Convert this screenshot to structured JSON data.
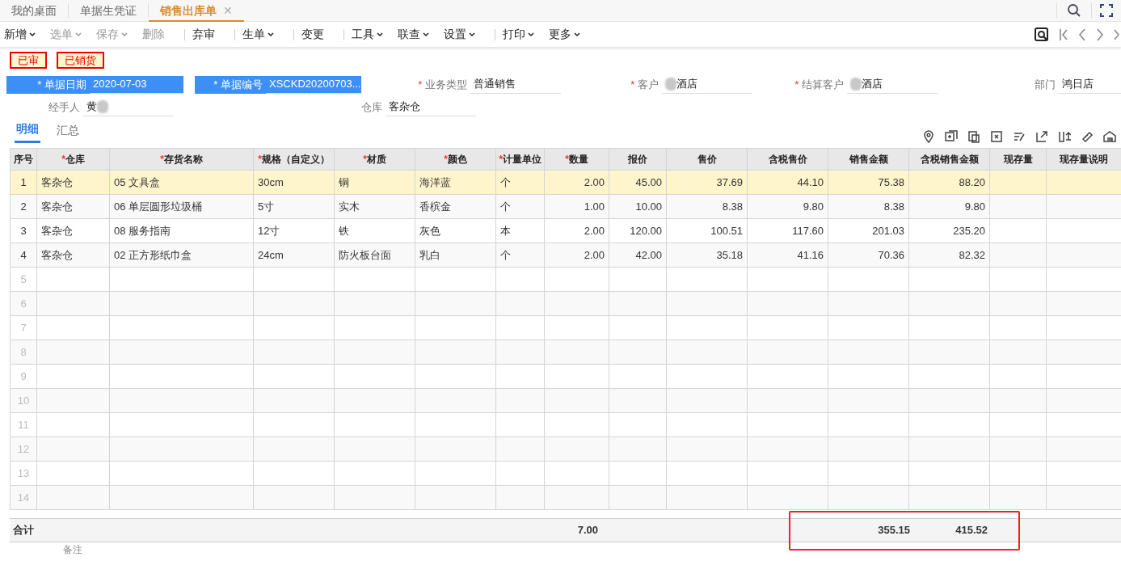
{
  "tabs": [
    {
      "label": "我的桌面",
      "selected": false,
      "closable": false
    },
    {
      "label": "单据生凭证",
      "selected": false,
      "closable": false
    },
    {
      "label": "销售出库单",
      "selected": true,
      "closable": true,
      "close_glyph": "✕"
    }
  ],
  "toolbar": [
    {
      "label": "新增",
      "disabled": false,
      "dropdown": true,
      "separator_before": false
    },
    {
      "label": "选单",
      "disabled": true,
      "dropdown": true,
      "separator_before": false
    },
    {
      "label": "保存",
      "disabled": true,
      "dropdown": true,
      "separator_before": false
    },
    {
      "label": "删除",
      "disabled": true,
      "dropdown": false,
      "separator_before": false
    },
    {
      "label": "弃审",
      "disabled": false,
      "dropdown": false,
      "separator_before": true
    },
    {
      "label": "生单",
      "disabled": false,
      "dropdown": true,
      "separator_before": true
    },
    {
      "label": "变更",
      "disabled": false,
      "dropdown": false,
      "separator_before": true
    },
    {
      "label": "工具",
      "disabled": false,
      "dropdown": true,
      "separator_before": true
    },
    {
      "label": "联查",
      "disabled": false,
      "dropdown": true,
      "separator_before": false
    },
    {
      "label": "设置",
      "disabled": false,
      "dropdown": true,
      "separator_before": false
    },
    {
      "label": "打印",
      "disabled": false,
      "dropdown": true,
      "separator_before": true
    },
    {
      "label": "更多",
      "disabled": false,
      "dropdown": true,
      "separator_before": false
    }
  ],
  "status_stamps": [
    "已审",
    "已销货"
  ],
  "form_rows": [
    [
      {
        "label": "单据日期",
        "required_mark": "*",
        "highlighted": true,
        "value": "2020-07-03",
        "blurred": false
      },
      {
        "label": "单据编号",
        "required_mark": "*",
        "highlighted": true,
        "value": "XSCKD20200703...",
        "blurred": false
      },
      {
        "label": "业务类型",
        "required_mark": "*",
        "highlighted": false,
        "value": "普通销售",
        "blurred": false
      },
      {
        "label": "客户",
        "required_mark": "*",
        "highlighted": false,
        "value": "酒店",
        "blurred": true
      },
      {
        "label": "结算客户",
        "required_mark": "*",
        "highlighted": false,
        "value": "酒店",
        "blurred": true
      },
      {
        "label": "部门",
        "highlighted": false,
        "value": "鸿日店",
        "blurred": false
      }
    ],
    [
      {
        "label": "经手人",
        "highlighted": false,
        "value": "黄",
        "blurred": true
      },
      {
        "label": "仓库",
        "highlighted": false,
        "value": "客杂仓",
        "blurred": false
      }
    ]
  ],
  "detail_tabs": [
    {
      "label": "明细",
      "selected": true
    },
    {
      "label": "汇总",
      "selected": false
    }
  ],
  "table": {
    "columns": [
      {
        "label": "序号"
      },
      {
        "label": "仓库",
        "required_mark": "*"
      },
      {
        "label": "存货名称",
        "required_mark": "*"
      },
      {
        "label": "规格（自定义）",
        "required_mark": "*"
      },
      {
        "label": "材质",
        "required_mark": "*"
      },
      {
        "label": "颜色",
        "required_mark": "*"
      },
      {
        "label": "计量单位",
        "required_mark": "*"
      },
      {
        "label": "数量",
        "required_mark": "*"
      },
      {
        "label": "报价"
      },
      {
        "label": "售价"
      },
      {
        "label": "含税售价"
      },
      {
        "label": "销售金额"
      },
      {
        "label": "含税销售金额"
      },
      {
        "label": "现存量"
      },
      {
        "label": "现存量说明"
      }
    ],
    "rows": [
      {
        "selected": true,
        "cells": [
          "1",
          "客杂仓",
          "05 文具盒",
          "30cm",
          "铜",
          "海洋蓝",
          "个",
          "2.00",
          "45.00",
          "37.69",
          "44.10",
          "75.38",
          "88.20"
        ]
      },
      {
        "selected": false,
        "cells": [
          "2",
          "客杂仓",
          "06 单层圆形垃圾桶",
          "5寸",
          "实木",
          "香槟金",
          "个",
          "1.00",
          "10.00",
          "8.38",
          "9.80",
          "8.38",
          "9.80"
        ]
      },
      {
        "selected": false,
        "cells": [
          "3",
          "客杂仓",
          "08 服务指南",
          "12寸",
          "铁",
          "灰色",
          "本",
          "2.00",
          "120.00",
          "100.51",
          "117.60",
          "201.03",
          "235.20"
        ]
      },
      {
        "selected": false,
        "cells": [
          "4",
          "客杂仓",
          "02 正方形纸巾盒",
          "24cm",
          "防火板台面",
          "乳白",
          "个",
          "2.00",
          "42.00",
          "35.18",
          "41.16",
          "70.36",
          "82.32"
        ]
      },
      {
        "selected": false,
        "cells": [
          "5"
        ]
      },
      {
        "selected": false,
        "cells": [
          "6"
        ]
      },
      {
        "selected": false,
        "cells": [
          "7"
        ]
      },
      {
        "selected": false,
        "cells": [
          "8"
        ]
      },
      {
        "selected": false,
        "cells": [
          "9"
        ]
      },
      {
        "selected": false,
        "cells": [
          "10"
        ]
      },
      {
        "selected": false,
        "cells": [
          "11"
        ]
      },
      {
        "selected": false,
        "cells": [
          "12"
        ]
      },
      {
        "selected": false,
        "cells": [
          "13"
        ]
      },
      {
        "selected": false,
        "cells": [
          "14"
        ]
      }
    ],
    "total": {
      "label": "合计",
      "quantity": "7.00",
      "sales_amount": "355.15",
      "sales_amount_with_tax": "415.52"
    }
  },
  "remarks_label": "备注"
}
